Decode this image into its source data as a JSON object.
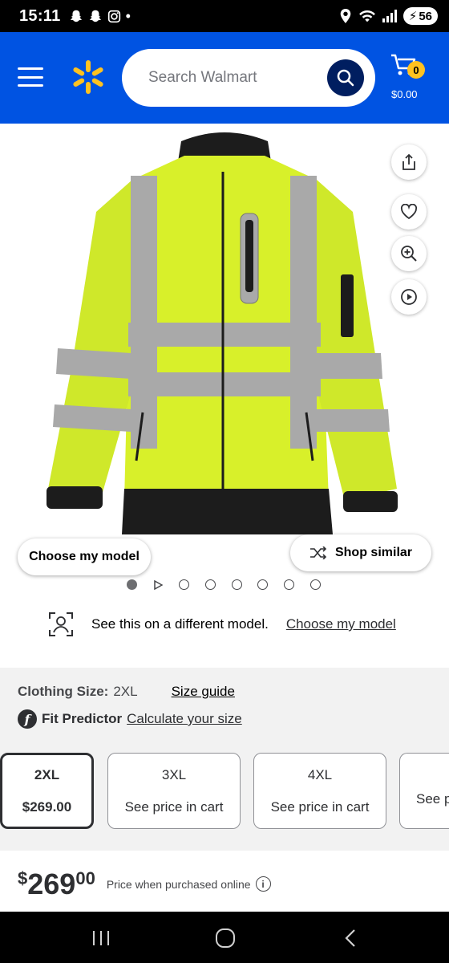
{
  "status_bar": {
    "time": "15:11",
    "battery": "56"
  },
  "header": {
    "search_placeholder": "Search Walmart",
    "cart_count": "0",
    "cart_total": "$0.00",
    "brand_color": "#0053e2",
    "accent_color": "#ffc220"
  },
  "product": {
    "image_description_icon": "hi-vis-jacket-image",
    "actions": [
      "share",
      "favorite",
      "zoom",
      "play-video"
    ],
    "choose_model_label": "Choose my model",
    "shop_similar_label": "Shop similar",
    "carousel": {
      "total_items": 8,
      "active_index": 0
    }
  },
  "model_row": {
    "text": "See this on a different model.",
    "link": "Choose my model"
  },
  "size_section": {
    "label": "Clothing Size:",
    "value": "2XL",
    "size_guide": "Size guide",
    "fit_label": "Fit Predictor",
    "fit_link": "Calculate your size",
    "options": [
      {
        "size": "2XL",
        "price": "$269.00",
        "selected": true
      },
      {
        "size": "3XL",
        "price": "See price in cart",
        "selected": false
      },
      {
        "size": "4XL",
        "price": "See price in cart",
        "selected": false
      },
      {
        "size": "",
        "price": "See p",
        "selected": false
      }
    ]
  },
  "price": {
    "currency": "$",
    "dollars": "269",
    "cents": "00",
    "note": "Price when purchased online"
  }
}
